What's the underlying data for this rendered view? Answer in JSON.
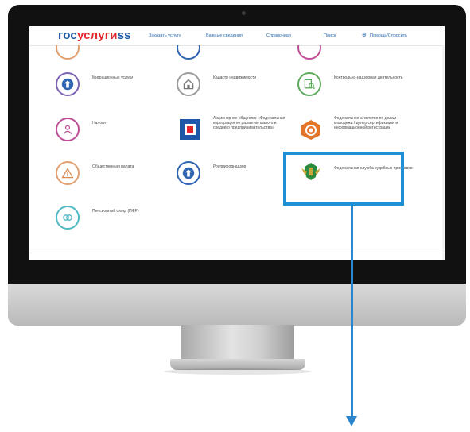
{
  "screen": {
    "logo": {
      "part1": "гос",
      "part2": "услуги",
      "part3": "ss"
    },
    "nav": {
      "links": [
        "Заказать услугу",
        "Важные сведения",
        "Справочная",
        "Поиск",
        "Помощь/Спросить"
      ],
      "cart_icon": "cart-icon"
    },
    "tiles": [
      {
        "label": "Миграционные услуги",
        "icon": "eagle-emblem-icon",
        "color": "#7c63b3"
      },
      {
        "label": "Кадастр недвижимости",
        "icon": "house-document-icon",
        "color": "#9b9b9b"
      },
      {
        "label": "Контрольно-надзорная деятельность",
        "icon": "document-search-icon",
        "color": "#5daa5d"
      },
      {
        "label": "Налоги",
        "icon": "people-icon",
        "color": "#c04e97"
      },
      {
        "label": "Акционерное общество «Федеральная корпорация по развитию малого и среднего предпринимательства»",
        "icon": "corporation-logo-icon",
        "color": "#1f56a8"
      },
      {
        "label": "Федеральное агентство по делам молодежи / центр сертификации и информационной регистрации",
        "icon": "spiral-icon",
        "color": "#e2752a"
      },
      {
        "label": "Общественная палата",
        "icon": "warning-icon",
        "color": "#e2a070"
      },
      {
        "label": "Росприроднадзор",
        "icon": "eagle-emblem-icon",
        "color": "#2f64b1"
      },
      {
        "label": "Федеральная служба судебных приставов",
        "icon": "fssp-emblem-icon",
        "color": "#c9a53a"
      },
      {
        "label": "Пенсионный фонд (ПФР)",
        "icon": "coins-icon",
        "color": "#4fb9c4"
      }
    ]
  },
  "callout": {
    "highlight_color": "#1e91d6",
    "arrow_color": "#2a86cf"
  }
}
